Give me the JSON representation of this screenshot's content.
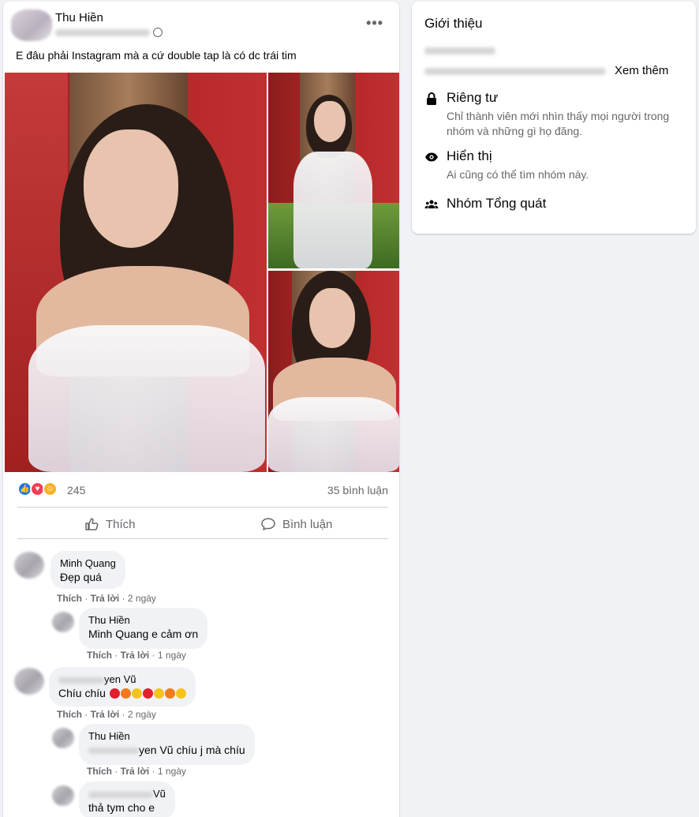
{
  "post": {
    "author": "Thu Hiền",
    "text": "E đâu phải Instagram mà a cứ double tap là có dc trái tim",
    "more_icon": "ellipsis-icon",
    "reactions": {
      "count": "245",
      "comments": "35 bình luận",
      "icons": [
        "like-icon",
        "love-icon",
        "care-icon"
      ],
      "colors": {
        "like": "#1877f2",
        "love": "#f33e58",
        "care": "#f7b125"
      }
    },
    "actions": {
      "like_label": "Thích",
      "comment_label": "Bình luận"
    },
    "comments": [
      {
        "name": "Minh Quang",
        "text": "Đẹp quá",
        "like": "Thích",
        "reply": "Trả lời",
        "time": "2 ngày",
        "replies": [
          {
            "name": "Thu Hiền",
            "mention": "Minh Quang",
            "text": "e cảm ơn",
            "like": "Thích",
            "reply": "Trả lời",
            "time": "1 ngày"
          }
        ]
      },
      {
        "name": "yen Vũ",
        "text": "Chíu chíu",
        "emoji": [
          "red-heart",
          "orange-heart",
          "yellow-heart",
          "red-heart",
          "yellow-heart",
          "orange-heart",
          "yellow-heart"
        ],
        "like": "Thích",
        "reply": "Trả lời",
        "time": "2 ngày",
        "replies": [
          {
            "name": "Thu Hiền",
            "mention": "yen Vũ",
            "text": "chíu j mà chíu",
            "like": "Thích",
            "reply": "Trả lời",
            "time": "1 ngày"
          },
          {
            "name": "Vũ",
            "text": "thả tym cho e"
          }
        ]
      }
    ]
  },
  "about": {
    "title": "Giới thiệu",
    "see_more": "Xem thêm",
    "items": [
      {
        "icon": "lock-icon",
        "title": "Riêng tư",
        "desc": "Chỉ thành viên mới nhìn thấy mọi người trong nhóm và những gì họ đăng."
      },
      {
        "icon": "eye-icon",
        "title": "Hiển thị",
        "desc": "Ai cũng có thể tìm nhóm này."
      },
      {
        "icon": "group-icon",
        "title": "Nhóm Tổng quát",
        "desc": ""
      }
    ]
  }
}
